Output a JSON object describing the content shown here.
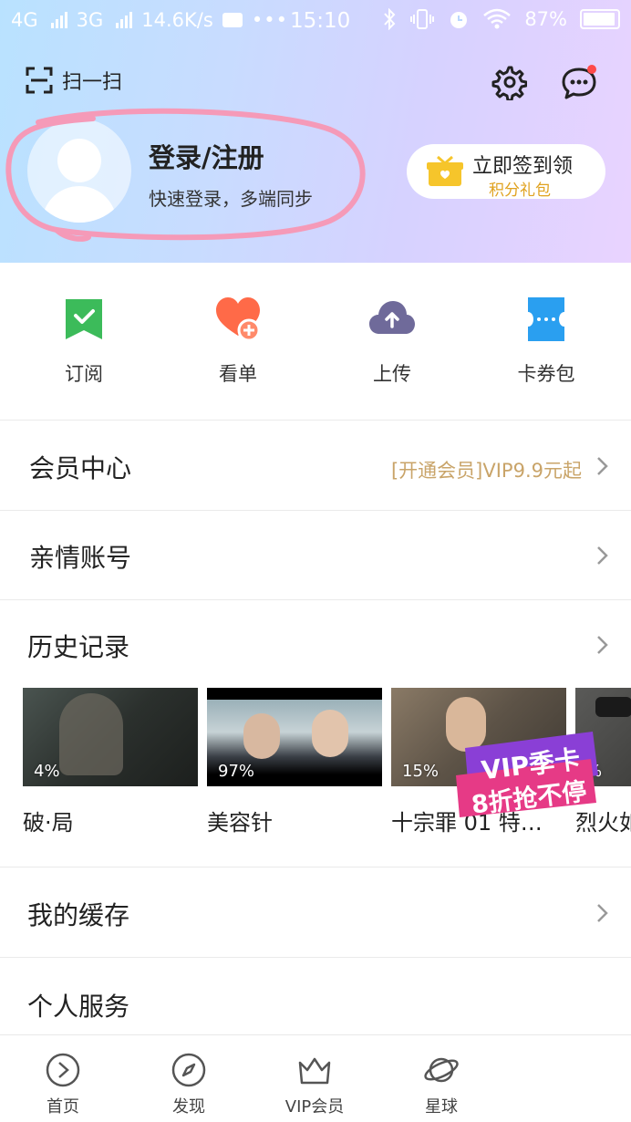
{
  "status_bar": {
    "network1": "4G",
    "network2": "3G",
    "speed": "14.6K/s",
    "dots": "•••",
    "time": "15:10",
    "battery": "87%"
  },
  "top": {
    "scan_label": "扫一扫"
  },
  "profile": {
    "title": "登录/注册",
    "subtitle": "快速登录，多端同步"
  },
  "signin": {
    "line1": "立即签到领",
    "line2": "积分礼包"
  },
  "quick_actions": [
    {
      "label": "订阅",
      "icon": "bookmark-icon",
      "color": "#3cbb5a"
    },
    {
      "label": "看单",
      "icon": "heart-add-icon",
      "color": "#ff6a48"
    },
    {
      "label": "上传",
      "icon": "cloud-upload-icon",
      "color": "#6f6a9a"
    },
    {
      "label": "卡券包",
      "icon": "ticket-icon",
      "color": "#2a9ff0"
    }
  ],
  "menu": {
    "vip": {
      "label": "会员中心",
      "extra": "[开通会员]VIP9.9元起"
    },
    "family": {
      "label": "亲情账号"
    },
    "history": {
      "label": "历史记录"
    },
    "cache": {
      "label": "我的缓存"
    },
    "personal": {
      "label": "个人服务"
    }
  },
  "history_items": [
    {
      "title": "破·局",
      "progress": "4%"
    },
    {
      "title": "美容针",
      "progress": "97%"
    },
    {
      "title": "十宗罪 01 特…",
      "progress": "15%"
    },
    {
      "title": "烈火如",
      "progress": "%"
    }
  ],
  "vip_ad": {
    "line1": "VIP季卡",
    "line2": "8折抢不停"
  },
  "tabs": [
    {
      "label": "首页",
      "icon": "play-circle-icon"
    },
    {
      "label": "发现",
      "icon": "compass-icon"
    },
    {
      "label": "VIP会员",
      "icon": "crown-icon"
    },
    {
      "label": "星球",
      "icon": "planet-icon"
    }
  ],
  "colors": {
    "accent_gold": "#c9a469",
    "gift_yellow": "#f6c52b"
  }
}
